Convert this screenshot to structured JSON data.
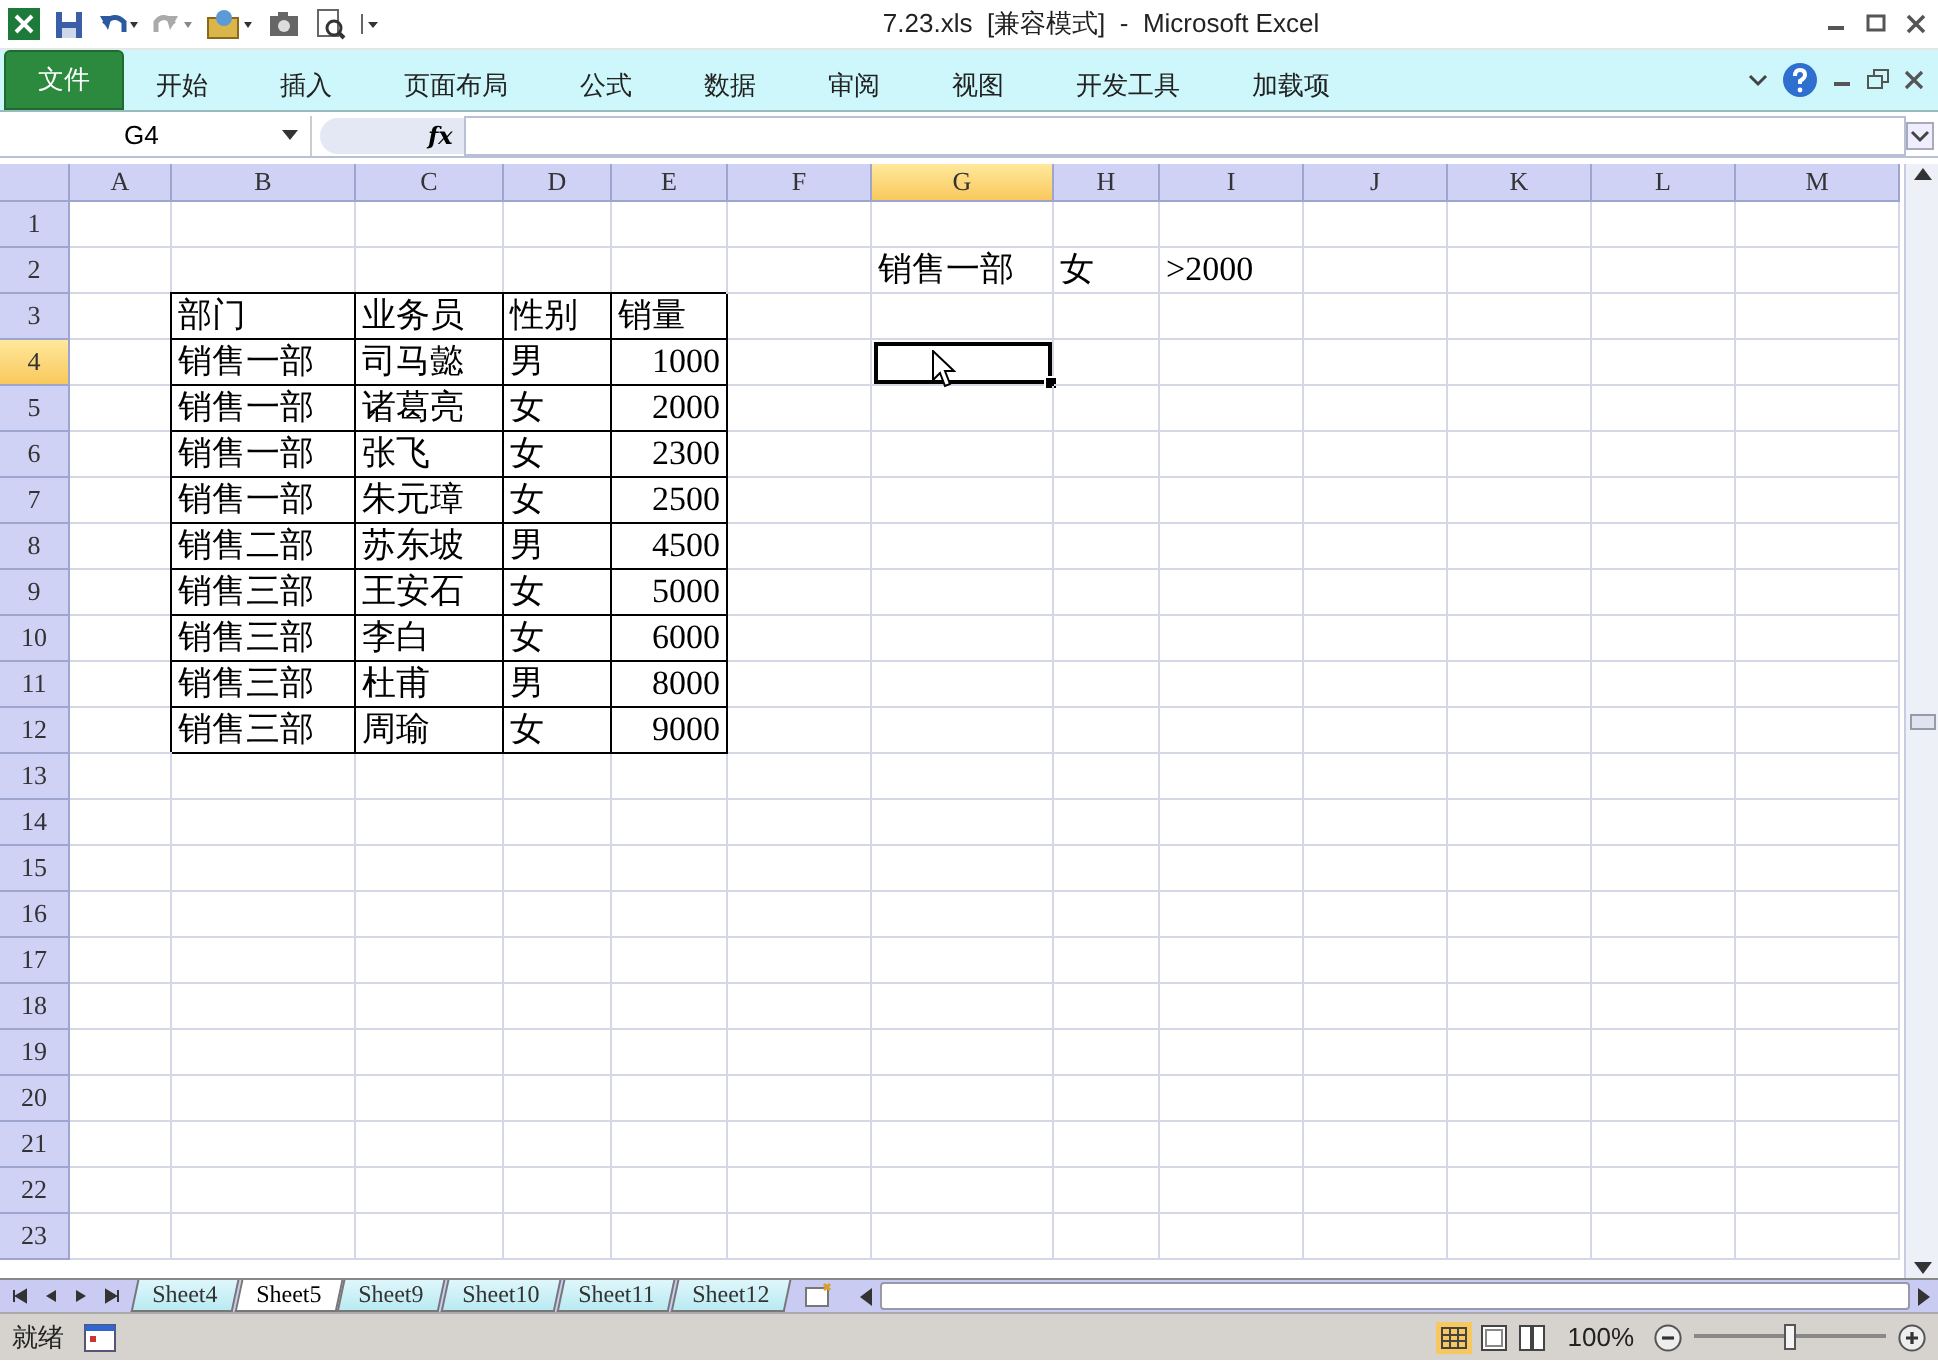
{
  "title_bar": {
    "title": "7.23.xls  [兼容模式]  -  Microsoft Excel"
  },
  "ribbon_tabs": [
    {
      "label": "文件",
      "kind": "file"
    },
    {
      "label": "开始",
      "kind": "tab"
    },
    {
      "label": "插入",
      "kind": "tab"
    },
    {
      "label": "页面布局",
      "kind": "tab"
    },
    {
      "label": "公式",
      "kind": "tab"
    },
    {
      "label": "数据",
      "kind": "tab"
    },
    {
      "label": "审阅",
      "kind": "tab"
    },
    {
      "label": "视图",
      "kind": "tab"
    },
    {
      "label": "开发工具",
      "kind": "tab"
    },
    {
      "label": "加载项",
      "kind": "tab"
    }
  ],
  "formula_bar": {
    "name_box": "G4",
    "function_label": "fx"
  },
  "sheet": {
    "columns": [
      {
        "label": "A",
        "selected": false
      },
      {
        "label": "B",
        "selected": false
      },
      {
        "label": "C",
        "selected": false
      },
      {
        "label": "D",
        "selected": false
      },
      {
        "label": "E",
        "selected": false
      },
      {
        "label": "F",
        "selected": false
      },
      {
        "label": "G",
        "selected": true
      },
      {
        "label": "H",
        "selected": false
      },
      {
        "label": "I",
        "selected": false
      },
      {
        "label": "J",
        "selected": false
      },
      {
        "label": "K",
        "selected": false
      },
      {
        "label": "L",
        "selected": false
      },
      {
        "label": "M",
        "selected": false
      }
    ],
    "rows": [
      {
        "label": "1",
        "selected": false
      },
      {
        "label": "2",
        "selected": false,
        "cells": [
          {
            "text": "",
            "bordered": false
          },
          {
            "text": "",
            "bordered": false
          },
          {
            "text": "",
            "bordered": false
          },
          {
            "text": "",
            "bordered": false
          },
          {
            "text": "",
            "bordered": false
          },
          {
            "text": "",
            "bordered": false
          },
          {
            "text": "销售一部",
            "kind": "text",
            "bordered": false
          },
          {
            "text": "女",
            "kind": "text",
            "bordered": false
          },
          {
            "text": ">2000",
            "kind": "text",
            "bordered": false
          },
          {
            "text": "",
            "bordered": false
          },
          {
            "text": "",
            "bordered": false
          },
          {
            "text": "",
            "bordered": false
          },
          {
            "text": "",
            "bordered": false
          }
        ]
      },
      {
        "label": "3",
        "selected": false,
        "cells": [
          {
            "text": "",
            "bordered": false
          },
          {
            "text": "部门",
            "kind": "text",
            "bordered": true
          },
          {
            "text": "业务员",
            "kind": "text",
            "bordered": true
          },
          {
            "text": "性别",
            "kind": "text",
            "bordered": true
          },
          {
            "text": "销量",
            "kind": "text",
            "bordered": true
          },
          {
            "text": "",
            "bordered": false
          },
          {
            "text": "",
            "bordered": false
          },
          {
            "text": "",
            "bordered": false
          },
          {
            "text": "",
            "bordered": false
          },
          {
            "text": "",
            "bordered": false
          },
          {
            "text": "",
            "bordered": false
          },
          {
            "text": "",
            "bordered": false
          },
          {
            "text": "",
            "bordered": false
          }
        ]
      },
      {
        "label": "4",
        "selected": true,
        "cells": [
          {
            "text": "",
            "bordered": false
          },
          {
            "text": "销售一部",
            "kind": "text",
            "bordered": true
          },
          {
            "text": "司马懿",
            "kind": "text",
            "bordered": true
          },
          {
            "text": "男",
            "kind": "text",
            "bordered": true
          },
          {
            "text": "1000",
            "kind": "number",
            "bordered": true
          },
          {
            "text": "",
            "bordered": false
          },
          {
            "text": "",
            "bordered": false
          },
          {
            "text": "",
            "bordered": false
          },
          {
            "text": "",
            "bordered": false
          },
          {
            "text": "",
            "bordered": false
          },
          {
            "text": "",
            "bordered": false
          },
          {
            "text": "",
            "bordered": false
          },
          {
            "text": "",
            "bordered": false
          }
        ]
      },
      {
        "label": "5",
        "selected": false,
        "cells": [
          {
            "text": "",
            "bordered": false
          },
          {
            "text": "销售一部",
            "kind": "text",
            "bordered": true
          },
          {
            "text": "诸葛亮",
            "kind": "text",
            "bordered": true
          },
          {
            "text": "女",
            "kind": "text",
            "bordered": true
          },
          {
            "text": "2000",
            "kind": "number",
            "bordered": true
          },
          {
            "text": "",
            "bordered": false
          },
          {
            "text": "",
            "bordered": false
          },
          {
            "text": "",
            "bordered": false
          },
          {
            "text": "",
            "bordered": false
          },
          {
            "text": "",
            "bordered": false
          },
          {
            "text": "",
            "bordered": false
          },
          {
            "text": "",
            "bordered": false
          },
          {
            "text": "",
            "bordered": false
          }
        ]
      },
      {
        "label": "6",
        "selected": false,
        "cells": [
          {
            "text": "",
            "bordered": false
          },
          {
            "text": "销售一部",
            "kind": "text",
            "bordered": true
          },
          {
            "text": "张飞",
            "kind": "text",
            "bordered": true
          },
          {
            "text": "女",
            "kind": "text",
            "bordered": true
          },
          {
            "text": "2300",
            "kind": "number",
            "bordered": true
          },
          {
            "text": "",
            "bordered": false
          },
          {
            "text": "",
            "bordered": false
          },
          {
            "text": "",
            "bordered": false
          },
          {
            "text": "",
            "bordered": false
          },
          {
            "text": "",
            "bordered": false
          },
          {
            "text": "",
            "bordered": false
          },
          {
            "text": "",
            "bordered": false
          },
          {
            "text": "",
            "bordered": false
          }
        ]
      },
      {
        "label": "7",
        "selected": false,
        "cells": [
          {
            "text": "",
            "bordered": false
          },
          {
            "text": "销售一部",
            "kind": "text",
            "bordered": true
          },
          {
            "text": "朱元璋",
            "kind": "text",
            "bordered": true
          },
          {
            "text": "女",
            "kind": "text",
            "bordered": true
          },
          {
            "text": "2500",
            "kind": "number",
            "bordered": true
          },
          {
            "text": "",
            "bordered": false
          },
          {
            "text": "",
            "bordered": false
          },
          {
            "text": "",
            "bordered": false
          },
          {
            "text": "",
            "bordered": false
          },
          {
            "text": "",
            "bordered": false
          },
          {
            "text": "",
            "bordered": false
          },
          {
            "text": "",
            "bordered": false
          },
          {
            "text": "",
            "bordered": false
          }
        ]
      },
      {
        "label": "8",
        "selected": false,
        "cells": [
          {
            "text": "",
            "bordered": false
          },
          {
            "text": "销售二部",
            "kind": "text",
            "bordered": true
          },
          {
            "text": "苏东坡",
            "kind": "text",
            "bordered": true
          },
          {
            "text": "男",
            "kind": "text",
            "bordered": true
          },
          {
            "text": "4500",
            "kind": "number",
            "bordered": true
          },
          {
            "text": "",
            "bordered": false
          },
          {
            "text": "",
            "bordered": false
          },
          {
            "text": "",
            "bordered": false
          },
          {
            "text": "",
            "bordered": false
          },
          {
            "text": "",
            "bordered": false
          },
          {
            "text": "",
            "bordered": false
          },
          {
            "text": "",
            "bordered": false
          },
          {
            "text": "",
            "bordered": false
          }
        ]
      },
      {
        "label": "9",
        "selected": false,
        "cells": [
          {
            "text": "",
            "bordered": false
          },
          {
            "text": "销售三部",
            "kind": "text",
            "bordered": true
          },
          {
            "text": "王安石",
            "kind": "text",
            "bordered": true
          },
          {
            "text": "女",
            "kind": "text",
            "bordered": true
          },
          {
            "text": "5000",
            "kind": "number",
            "bordered": true
          },
          {
            "text": "",
            "bordered": false
          },
          {
            "text": "",
            "bordered": false
          },
          {
            "text": "",
            "bordered": false
          },
          {
            "text": "",
            "bordered": false
          },
          {
            "text": "",
            "bordered": false
          },
          {
            "text": "",
            "bordered": false
          },
          {
            "text": "",
            "bordered": false
          },
          {
            "text": "",
            "bordered": false
          }
        ]
      },
      {
        "label": "10",
        "selected": false,
        "cells": [
          {
            "text": "",
            "bordered": false
          },
          {
            "text": "销售三部",
            "kind": "text",
            "bordered": true
          },
          {
            "text": "李白",
            "kind": "text",
            "bordered": true
          },
          {
            "text": "女",
            "kind": "text",
            "bordered": true
          },
          {
            "text": "6000",
            "kind": "number",
            "bordered": true
          },
          {
            "text": "",
            "bordered": false
          },
          {
            "text": "",
            "bordered": false
          },
          {
            "text": "",
            "bordered": false
          },
          {
            "text": "",
            "bordered": false
          },
          {
            "text": "",
            "bordered": false
          },
          {
            "text": "",
            "bordered": false
          },
          {
            "text": "",
            "bordered": false
          },
          {
            "text": "",
            "bordered": false
          }
        ]
      },
      {
        "label": "11",
        "selected": false,
        "cells": [
          {
            "text": "",
            "bordered": false
          },
          {
            "text": "销售三部",
            "kind": "text",
            "bordered": true
          },
          {
            "text": "杜甫",
            "kind": "text",
            "bordered": true
          },
          {
            "text": "男",
            "kind": "text",
            "bordered": true
          },
          {
            "text": "8000",
            "kind": "number",
            "bordered": true
          },
          {
            "text": "",
            "bordered": false
          },
          {
            "text": "",
            "bordered": false
          },
          {
            "text": "",
            "bordered": false
          },
          {
            "text": "",
            "bordered": false
          },
          {
            "text": "",
            "bordered": false
          },
          {
            "text": "",
            "bordered": false
          },
          {
            "text": "",
            "bordered": false
          },
          {
            "text": "",
            "bordered": false
          }
        ]
      },
      {
        "label": "12",
        "selected": false,
        "cells": [
          {
            "text": "",
            "bordered": false
          },
          {
            "text": "销售三部",
            "kind": "text",
            "bordered": true
          },
          {
            "text": "周瑜",
            "kind": "text",
            "bordered": true
          },
          {
            "text": "女",
            "kind": "text",
            "bordered": true
          },
          {
            "text": "9000",
            "kind": "number",
            "bordered": true
          },
          {
            "text": "",
            "bordered": false
          },
          {
            "text": "",
            "bordered": false
          },
          {
            "text": "",
            "bordered": false
          },
          {
            "text": "",
            "bordered": false
          },
          {
            "text": "",
            "bordered": false
          },
          {
            "text": "",
            "bordered": false
          },
          {
            "text": "",
            "bordered": false
          },
          {
            "text": "",
            "bordered": false
          }
        ]
      },
      {
        "label": "13",
        "selected": false
      },
      {
        "label": "14",
        "selected": false
      },
      {
        "label": "15",
        "selected": false
      },
      {
        "label": "16",
        "selected": false
      },
      {
        "label": "17",
        "selected": false
      },
      {
        "label": "18",
        "selected": false
      },
      {
        "label": "19",
        "selected": false
      },
      {
        "label": "20",
        "selected": false
      },
      {
        "label": "21",
        "selected": false
      },
      {
        "label": "22",
        "selected": false
      },
      {
        "label": "23",
        "selected": false
      }
    ]
  },
  "sheet_tabs": [
    {
      "label": "Sheet4",
      "selected": false
    },
    {
      "label": "Sheet5",
      "selected": true
    },
    {
      "label": "Sheet9",
      "selected": false
    },
    {
      "label": "Sheet10",
      "selected": false
    },
    {
      "label": "Sheet11",
      "selected": false
    },
    {
      "label": "Sheet12",
      "selected": false
    }
  ],
  "status_bar": {
    "status": "就绪",
    "zoom_label": "100%",
    "zoom": {
      "level": 0.5
    }
  }
}
